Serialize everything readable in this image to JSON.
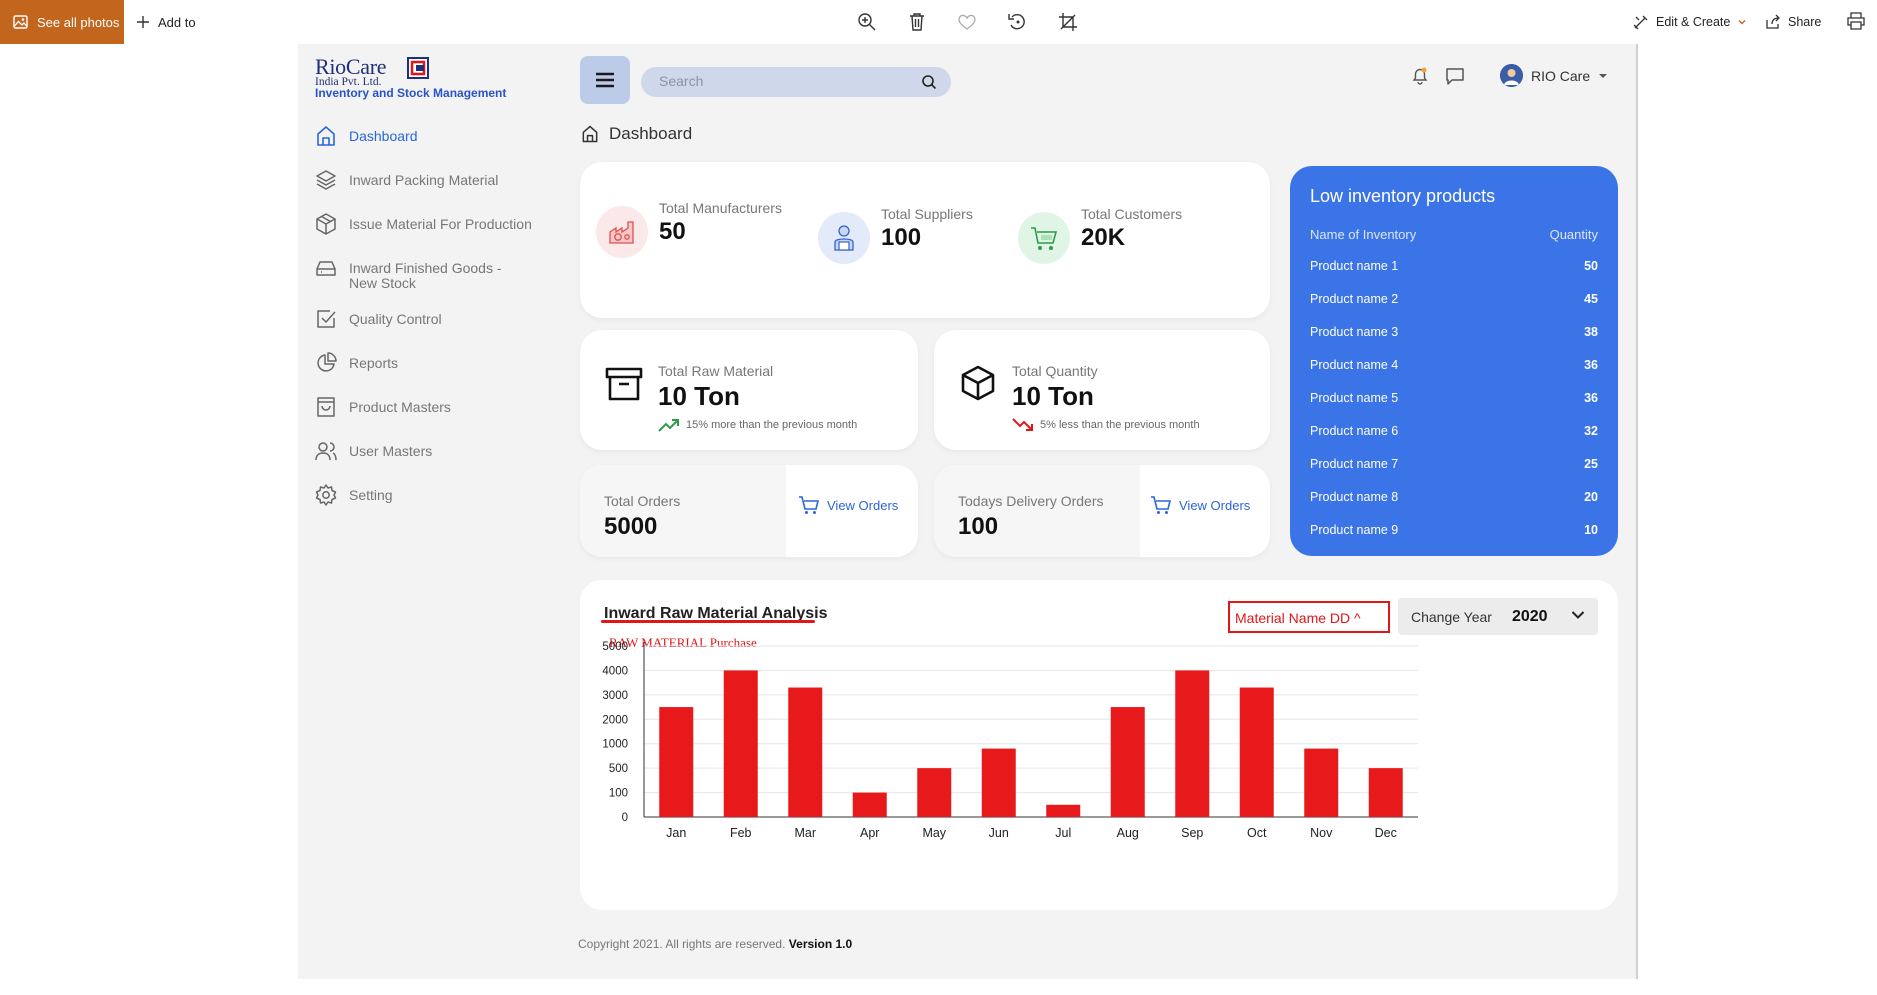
{
  "viewer": {
    "see_all_photos": "See all photos",
    "add_to": "Add to",
    "edit_create": "Edit & Create",
    "share": "Share"
  },
  "logo": {
    "brand": "RioCare",
    "company": "India Pvt. Ltd.",
    "tagline": "Inventory and Stock Management"
  },
  "sidebar": {
    "items": [
      {
        "label": "Dashboard",
        "icon": "home-icon",
        "active": true
      },
      {
        "label": "Inward Packing Material",
        "icon": "layers-icon"
      },
      {
        "label": "Issue Material For Production",
        "icon": "box-icon"
      },
      {
        "label": "Inward Finished Goods -",
        "label2": "New Stock",
        "icon": "drive-icon"
      },
      {
        "label": "Quality Control",
        "icon": "check-square-icon"
      },
      {
        "label": "Reports",
        "icon": "pie-chart-icon"
      },
      {
        "label": "Product Masters",
        "icon": "bag-icon"
      },
      {
        "label": "User Masters",
        "icon": "users-icon"
      },
      {
        "label": "Setting",
        "icon": "gear-icon"
      }
    ]
  },
  "header": {
    "search_placeholder": "Search",
    "user_name": "RIO Care"
  },
  "breadcrumb": {
    "title": "Dashboard"
  },
  "stats": {
    "manufacturers": {
      "label": "Total Manufacturers",
      "value": "50"
    },
    "suppliers": {
      "label": "Total Suppliers",
      "value": "100"
    },
    "customers": {
      "label": "Total Customers",
      "value": "20K"
    },
    "raw_material": {
      "label": "Total Raw Material",
      "value": "10 Ton",
      "trend": "15% more than the previous month"
    },
    "quantity": {
      "label": "Total Quantity",
      "value": "10 Ton",
      "trend": "5% less than the previous month"
    },
    "orders": {
      "label": "Total Orders",
      "value": "5000",
      "link": "View Orders"
    },
    "delivery": {
      "label": "Todays Delivery Orders",
      "value": "100",
      "link": "View Orders"
    }
  },
  "low_inventory": {
    "title": "Low inventory products",
    "col_name": "Name of Inventory",
    "col_qty": "Quantity",
    "rows": [
      {
        "name": "Product name 1",
        "qty": "50"
      },
      {
        "name": "Product name 2",
        "qty": "45"
      },
      {
        "name": "Product name 3",
        "qty": "38"
      },
      {
        "name": "Product name 4",
        "qty": "36"
      },
      {
        "name": "Product name 5",
        "qty": "36"
      },
      {
        "name": "Product name 6",
        "qty": "32"
      },
      {
        "name": "Product name 7",
        "qty": "25"
      },
      {
        "name": "Product name 8",
        "qty": "20"
      },
      {
        "name": "Product name 9",
        "qty": "10"
      }
    ]
  },
  "analysis": {
    "title": "Inward Raw Material Analysis",
    "dropdown": "Material Name DD ^",
    "change_year_label": "Change Year",
    "year": "2020"
  },
  "chart_data": {
    "type": "bar",
    "title": "RAW MATERIAL Purchase",
    "categories": [
      "Jan",
      "Feb",
      "Mar",
      "Apr",
      "May",
      "Jun",
      "Jul",
      "Aug",
      "Sep",
      "Oct",
      "Nov",
      "Dec"
    ],
    "y_ticks": [
      "0",
      "100",
      "500",
      "1000",
      "2000",
      "3000",
      "4000",
      "5000"
    ],
    "values": [
      2500,
      4000,
      3300,
      100,
      500,
      900,
      50,
      2500,
      4000,
      3300,
      900,
      500
    ],
    "color": "#e8191b",
    "grid": true
  },
  "footer": {
    "copyright": "Copyright 2021. All rights are reserved.",
    "version": "Version 1.0"
  }
}
